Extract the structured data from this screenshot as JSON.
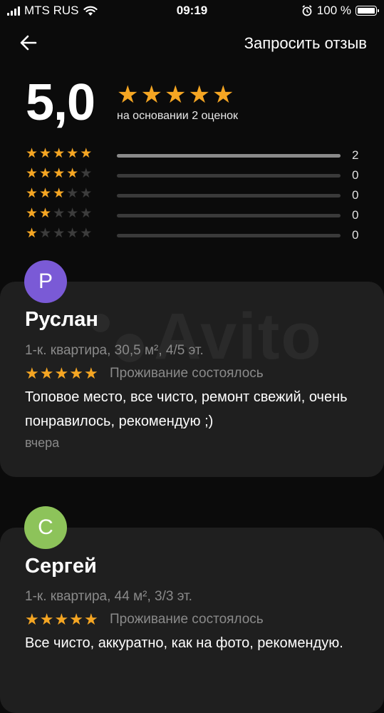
{
  "status_bar": {
    "carrier": "MTS RUS",
    "time": "09:19",
    "battery": "100 %"
  },
  "nav": {
    "back_icon": "arrow-left-icon",
    "request_review": "Запросить отзыв"
  },
  "rating": {
    "score": "5,0",
    "stars": 5,
    "caption": "на основании 2 оценок",
    "distribution": [
      {
        "stars": 5,
        "count": "2",
        "fraction": 1.0
      },
      {
        "stars": 4,
        "count": "0",
        "fraction": 0
      },
      {
        "stars": 3,
        "count": "0",
        "fraction": 0
      },
      {
        "stars": 2,
        "count": "0",
        "fraction": 0
      },
      {
        "stars": 1,
        "count": "0",
        "fraction": 0
      }
    ]
  },
  "watermark": "Avito",
  "colors": {
    "star": "#f5a623",
    "star_off": "#3c3c3c",
    "card_bg": "#1f1f1f"
  },
  "reviews": [
    {
      "avatar_letter": "Р",
      "avatar_color": "#7a5ad6",
      "author": "Руслан",
      "property": "1-к. квартира, 30,5 м², 4/5 эт.",
      "stars": 5,
      "stay": "Проживание состоялось",
      "text": "Топовое место, все чисто, ремонт свежий, очень понравилось, рекомендую ;)",
      "date": "вчера"
    },
    {
      "avatar_letter": "С",
      "avatar_color": "#8dc35a",
      "author": "Сергей",
      "property": "1-к. квартира, 44 м², 3/3 эт.",
      "stars": 5,
      "stay": "Проживание состоялось",
      "text": "Все чисто, аккуратно, как на фото, рекомендую."
    }
  ]
}
